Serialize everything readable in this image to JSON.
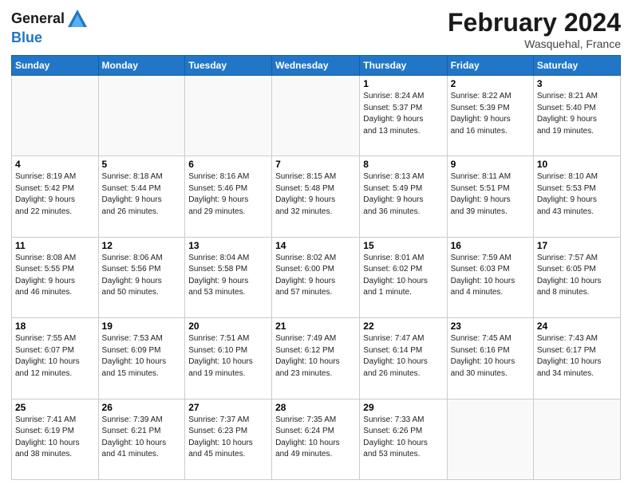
{
  "header": {
    "logo_line1": "General",
    "logo_line2": "Blue",
    "month_title": "February 2024",
    "location": "Wasquehal, France"
  },
  "days_of_week": [
    "Sunday",
    "Monday",
    "Tuesday",
    "Wednesday",
    "Thursday",
    "Friday",
    "Saturday"
  ],
  "weeks": [
    [
      {
        "day": "",
        "info": ""
      },
      {
        "day": "",
        "info": ""
      },
      {
        "day": "",
        "info": ""
      },
      {
        "day": "",
        "info": ""
      },
      {
        "day": "1",
        "info": "Sunrise: 8:24 AM\nSunset: 5:37 PM\nDaylight: 9 hours\nand 13 minutes."
      },
      {
        "day": "2",
        "info": "Sunrise: 8:22 AM\nSunset: 5:39 PM\nDaylight: 9 hours\nand 16 minutes."
      },
      {
        "day": "3",
        "info": "Sunrise: 8:21 AM\nSunset: 5:40 PM\nDaylight: 9 hours\nand 19 minutes."
      }
    ],
    [
      {
        "day": "4",
        "info": "Sunrise: 8:19 AM\nSunset: 5:42 PM\nDaylight: 9 hours\nand 22 minutes."
      },
      {
        "day": "5",
        "info": "Sunrise: 8:18 AM\nSunset: 5:44 PM\nDaylight: 9 hours\nand 26 minutes."
      },
      {
        "day": "6",
        "info": "Sunrise: 8:16 AM\nSunset: 5:46 PM\nDaylight: 9 hours\nand 29 minutes."
      },
      {
        "day": "7",
        "info": "Sunrise: 8:15 AM\nSunset: 5:48 PM\nDaylight: 9 hours\nand 32 minutes."
      },
      {
        "day": "8",
        "info": "Sunrise: 8:13 AM\nSunset: 5:49 PM\nDaylight: 9 hours\nand 36 minutes."
      },
      {
        "day": "9",
        "info": "Sunrise: 8:11 AM\nSunset: 5:51 PM\nDaylight: 9 hours\nand 39 minutes."
      },
      {
        "day": "10",
        "info": "Sunrise: 8:10 AM\nSunset: 5:53 PM\nDaylight: 9 hours\nand 43 minutes."
      }
    ],
    [
      {
        "day": "11",
        "info": "Sunrise: 8:08 AM\nSunset: 5:55 PM\nDaylight: 9 hours\nand 46 minutes."
      },
      {
        "day": "12",
        "info": "Sunrise: 8:06 AM\nSunset: 5:56 PM\nDaylight: 9 hours\nand 50 minutes."
      },
      {
        "day": "13",
        "info": "Sunrise: 8:04 AM\nSunset: 5:58 PM\nDaylight: 9 hours\nand 53 minutes."
      },
      {
        "day": "14",
        "info": "Sunrise: 8:02 AM\nSunset: 6:00 PM\nDaylight: 9 hours\nand 57 minutes."
      },
      {
        "day": "15",
        "info": "Sunrise: 8:01 AM\nSunset: 6:02 PM\nDaylight: 10 hours\nand 1 minute."
      },
      {
        "day": "16",
        "info": "Sunrise: 7:59 AM\nSunset: 6:03 PM\nDaylight: 10 hours\nand 4 minutes."
      },
      {
        "day": "17",
        "info": "Sunrise: 7:57 AM\nSunset: 6:05 PM\nDaylight: 10 hours\nand 8 minutes."
      }
    ],
    [
      {
        "day": "18",
        "info": "Sunrise: 7:55 AM\nSunset: 6:07 PM\nDaylight: 10 hours\nand 12 minutes."
      },
      {
        "day": "19",
        "info": "Sunrise: 7:53 AM\nSunset: 6:09 PM\nDaylight: 10 hours\nand 15 minutes."
      },
      {
        "day": "20",
        "info": "Sunrise: 7:51 AM\nSunset: 6:10 PM\nDaylight: 10 hours\nand 19 minutes."
      },
      {
        "day": "21",
        "info": "Sunrise: 7:49 AM\nSunset: 6:12 PM\nDaylight: 10 hours\nand 23 minutes."
      },
      {
        "day": "22",
        "info": "Sunrise: 7:47 AM\nSunset: 6:14 PM\nDaylight: 10 hours\nand 26 minutes."
      },
      {
        "day": "23",
        "info": "Sunrise: 7:45 AM\nSunset: 6:16 PM\nDaylight: 10 hours\nand 30 minutes."
      },
      {
        "day": "24",
        "info": "Sunrise: 7:43 AM\nSunset: 6:17 PM\nDaylight: 10 hours\nand 34 minutes."
      }
    ],
    [
      {
        "day": "25",
        "info": "Sunrise: 7:41 AM\nSunset: 6:19 PM\nDaylight: 10 hours\nand 38 minutes."
      },
      {
        "day": "26",
        "info": "Sunrise: 7:39 AM\nSunset: 6:21 PM\nDaylight: 10 hours\nand 41 minutes."
      },
      {
        "day": "27",
        "info": "Sunrise: 7:37 AM\nSunset: 6:23 PM\nDaylight: 10 hours\nand 45 minutes."
      },
      {
        "day": "28",
        "info": "Sunrise: 7:35 AM\nSunset: 6:24 PM\nDaylight: 10 hours\nand 49 minutes."
      },
      {
        "day": "29",
        "info": "Sunrise: 7:33 AM\nSunset: 6:26 PM\nDaylight: 10 hours\nand 53 minutes."
      },
      {
        "day": "",
        "info": ""
      },
      {
        "day": "",
        "info": ""
      }
    ]
  ]
}
